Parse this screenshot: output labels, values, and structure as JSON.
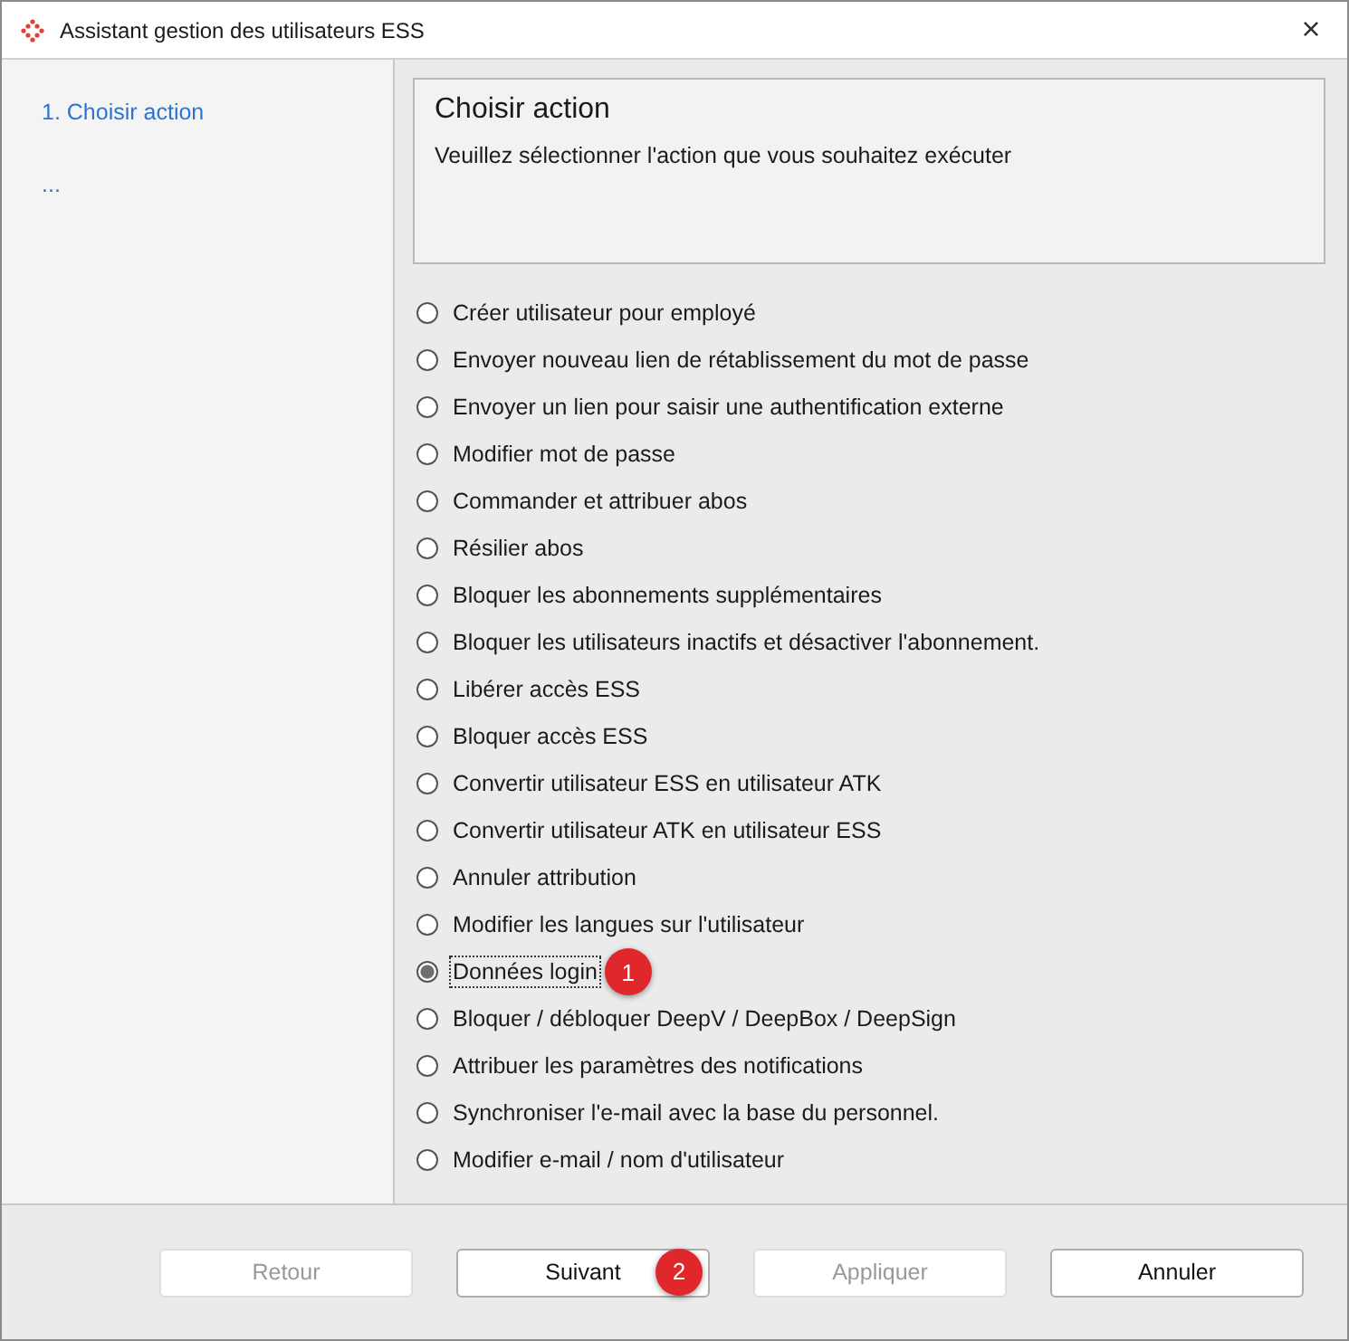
{
  "window": {
    "title": "Assistant gestion des utilisateurs ESS",
    "close": "×"
  },
  "steps": [
    {
      "label": "1. Choisir action"
    },
    {
      "label": "..."
    }
  ],
  "header": {
    "title": "Choisir action",
    "description": "Veuillez sélectionner l'action que vous souhaitez exécuter"
  },
  "options": [
    {
      "label": "Créer utilisateur pour employé",
      "selected": false
    },
    {
      "label": "Envoyer nouveau lien de rétablissement du mot de passe",
      "selected": false
    },
    {
      "label": "Envoyer un lien pour saisir une authentification externe",
      "selected": false
    },
    {
      "label": "Modifier mot de passe",
      "selected": false
    },
    {
      "label": "Commander et attribuer abos",
      "selected": false
    },
    {
      "label": "Résilier abos",
      "selected": false
    },
    {
      "label": "Bloquer les abonnements supplémentaires",
      "selected": false
    },
    {
      "label": "Bloquer les utilisateurs inactifs et désactiver l'abonnement.",
      "selected": false
    },
    {
      "label": "Libérer accès ESS",
      "selected": false
    },
    {
      "label": "Bloquer accès ESS",
      "selected": false
    },
    {
      "label": "Convertir utilisateur ESS en utilisateur ATK",
      "selected": false
    },
    {
      "label": "Convertir utilisateur ATK en utilisateur ESS",
      "selected": false
    },
    {
      "label": "Annuler attribution",
      "selected": false
    },
    {
      "label": "Modifier les langues sur l'utilisateur",
      "selected": false
    },
    {
      "label": "Données login",
      "selected": true,
      "badge": "1"
    },
    {
      "label": "Bloquer / débloquer DeepV / DeepBox / DeepSign",
      "selected": false
    },
    {
      "label": "Attribuer les paramètres des notifications",
      "selected": false
    },
    {
      "label": "Synchroniser l'e-mail avec la base du personnel.",
      "selected": false
    },
    {
      "label": "Modifier e-mail / nom d'utilisateur",
      "selected": false
    }
  ],
  "buttons": [
    {
      "label": "Retour",
      "disabled": true
    },
    {
      "label": "Suivant",
      "disabled": false,
      "badge": "2"
    },
    {
      "label": "Appliquer",
      "disabled": true
    },
    {
      "label": "Annuler",
      "disabled": false
    }
  ]
}
